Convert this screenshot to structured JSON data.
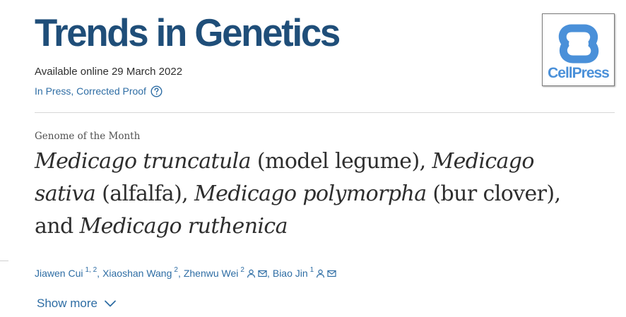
{
  "journal": {
    "title": "Trends in Genetics",
    "available": "Available online 29 March 2022",
    "status": "In Press, Corrected Proof",
    "publisher_logo_text": "CellPress"
  },
  "article": {
    "type": "Genome of the Month",
    "title_parts": {
      "sp1": "Medicago truncatula",
      "c1": " (model legume), ",
      "sp2": "Medicago sativa",
      "c2": " (alfalfa), ",
      "sp3": "Medicago polymorpha",
      "c3": " (bur clover), and ",
      "sp4": "Medicago ruthenica"
    }
  },
  "authors": [
    {
      "name": "Jiawen Cui",
      "affil": "1, 2"
    },
    {
      "name": "Xiaoshan Wang",
      "affil": "2"
    },
    {
      "name": "Zhenwu Wei",
      "affil": "2"
    },
    {
      "name": "Biao Jin",
      "affil": "1"
    }
  ],
  "show_more_label": "Show more",
  "colors": {
    "journal_title": "#1f4e79",
    "link": "#2e6da4",
    "cellpress_blue": "#4a90d9",
    "text": "#2e2e2e"
  },
  "icons": {
    "help": "help-circle-icon",
    "person": "person-icon",
    "email": "envelope-icon",
    "chevron": "chevron-down-icon"
  }
}
